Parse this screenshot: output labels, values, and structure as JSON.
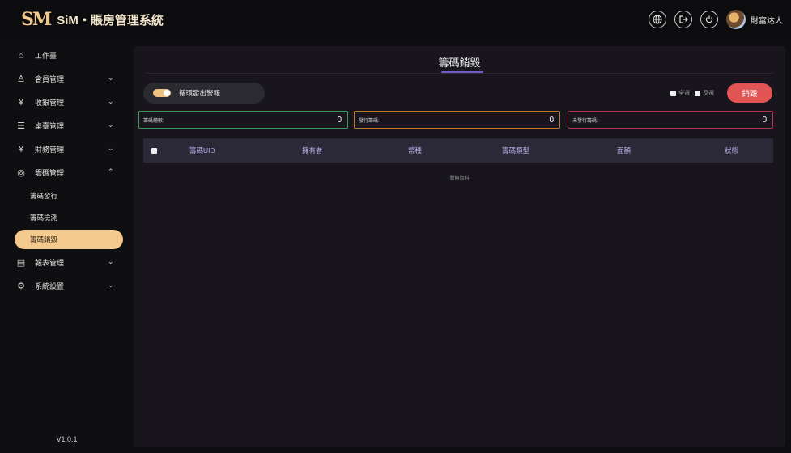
{
  "header": {
    "logo_mark": "SM",
    "title": "SiM・賬房管理系統",
    "username": "財富达人"
  },
  "icons": {
    "globe": "globe-icon",
    "logout": "logout-icon",
    "power": "power-icon"
  },
  "sidebar": {
    "items": [
      {
        "label": "工作臺",
        "icon": "⌂",
        "chevron": ""
      },
      {
        "label": "會員管理",
        "icon": "♙",
        "chevron": "⌄"
      },
      {
        "label": "收銀管理",
        "icon": "¥",
        "chevron": "⌄"
      },
      {
        "label": "桌臺管理",
        "icon": "☰",
        "chevron": "⌄"
      },
      {
        "label": "財務管理",
        "icon": "¥",
        "chevron": "⌄"
      },
      {
        "label": "籌碼管理",
        "icon": "◎",
        "chevron": "⌃"
      }
    ],
    "sub_items": [
      {
        "label": "籌碼發行"
      },
      {
        "label": "籌碼檢測"
      },
      {
        "label": "籌碼銷毀"
      }
    ],
    "items_after": [
      {
        "label": "報表管理",
        "icon": "▤",
        "chevron": "⌄"
      },
      {
        "label": "系統設置",
        "icon": "⚙",
        "chevron": "⌄"
      }
    ],
    "version": "V1.0.1"
  },
  "main": {
    "title": "籌碼銷毀",
    "toggle_label": "循環發出警報",
    "select_all": "全選",
    "invert_select": "反選",
    "destroy_button": "銷毀",
    "stats": [
      {
        "label": "籌碼總數:",
        "value": "0"
      },
      {
        "label": "發行籌碼:",
        "value": "0"
      },
      {
        "label": "未發行籌碼:",
        "value": "0"
      }
    ],
    "table": {
      "columns": [
        "籌碼UID",
        "擁有者",
        "幣種",
        "籌碼類型",
        "面額",
        "狀態"
      ]
    },
    "empty_text": "暫無資料"
  },
  "colors": {
    "accent": "#f3c98d",
    "danger": "#e35454",
    "tab_underline": "#6f5ac8",
    "stat_green": "#3e9a52",
    "stat_orange": "#c2792e",
    "stat_red": "#b03a4a"
  }
}
